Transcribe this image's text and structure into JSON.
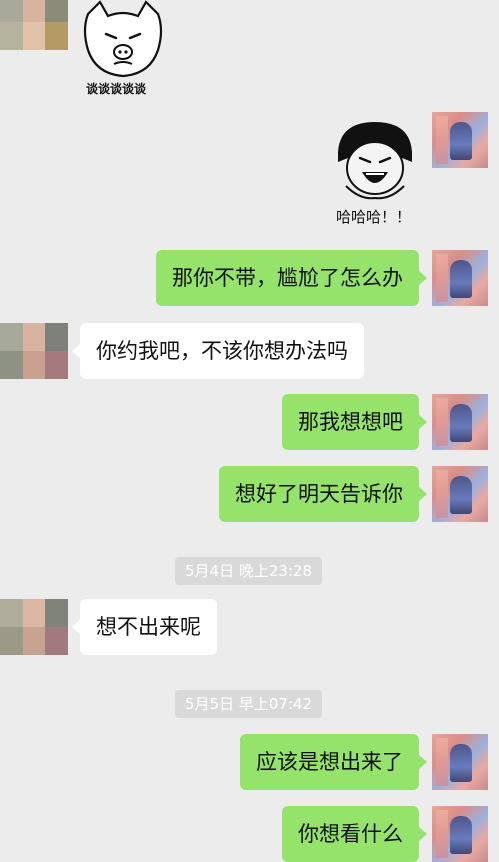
{
  "colors": {
    "chat_background": "#ececec",
    "my_bubble": "#95e36b",
    "other_bubble": "#ffffff",
    "timestamp_pill": "#d9d9d9"
  },
  "messages": [
    {
      "sender": "other",
      "type": "sticker",
      "icon": "pig-face-sticker",
      "caption": "谈谈谈谈谈"
    },
    {
      "sender": "me",
      "type": "sticker",
      "icon": "laughing-face-sticker",
      "caption": "哈哈哈！！"
    },
    {
      "sender": "me",
      "type": "text",
      "text": "那你不带，尴尬了怎么办"
    },
    {
      "sender": "other",
      "type": "text",
      "text": "你约我吧，不该你想办法吗"
    },
    {
      "sender": "me",
      "type": "text",
      "text": "那我想想吧"
    },
    {
      "sender": "me",
      "type": "text",
      "text": "想好了明天告诉你"
    },
    {
      "type": "timestamp",
      "text": "5月4日 晚上23:28"
    },
    {
      "sender": "other",
      "type": "text",
      "text": "想不出来呢"
    },
    {
      "type": "timestamp",
      "text": "5月5日 早上07:42"
    },
    {
      "sender": "me",
      "type": "text",
      "text": "应该是想出来了"
    },
    {
      "sender": "me",
      "type": "text",
      "text": "你想看什么"
    }
  ]
}
